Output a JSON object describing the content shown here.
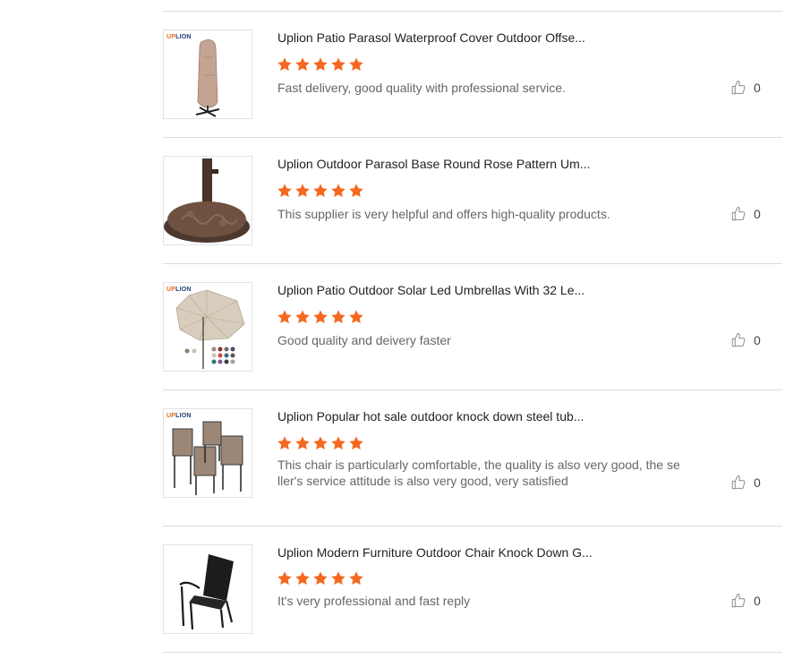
{
  "brand": {
    "part1": "UP",
    "part2": "LION"
  },
  "reviews": [
    {
      "title": "Uplion Patio Parasol Waterproof Cover Outdoor Offse...",
      "stars": 5,
      "comment": "Fast delivery, good quality with professional service.",
      "likes": "0",
      "thumb_icon": "parasol-cover-image"
    },
    {
      "title": "Uplion Outdoor Parasol Base Round Rose Pattern Um...",
      "stars": 5,
      "comment": "This supplier is very helpful and offers high-quality products.",
      "likes": "0",
      "thumb_icon": "parasol-base-image"
    },
    {
      "title": "Uplion Patio Outdoor Solar Led Umbrellas With 32 Le...",
      "stars": 5,
      "comment": "Good quality and deivery faster",
      "likes": "0",
      "thumb_icon": "solar-umbrella-image"
    },
    {
      "title": "Uplion Popular hot sale outdoor knock down steel tub...",
      "stars": 5,
      "comment": "This chair is particularly comfortable, the quality is also very good, the seller's service attitude is also very good, very satisfied",
      "likes": "0",
      "thumb_icon": "chair-set-image"
    },
    {
      "title": "Uplion Modern Furniture Outdoor Chair Knock Down G...",
      "stars": 5,
      "comment": "It's very professional and fast reply",
      "likes": "0",
      "thumb_icon": "black-chair-image"
    }
  ],
  "colors": {
    "star": "#f5681f",
    "divider": "#dcdcdc",
    "title": "#222222",
    "comment": "#666666"
  }
}
